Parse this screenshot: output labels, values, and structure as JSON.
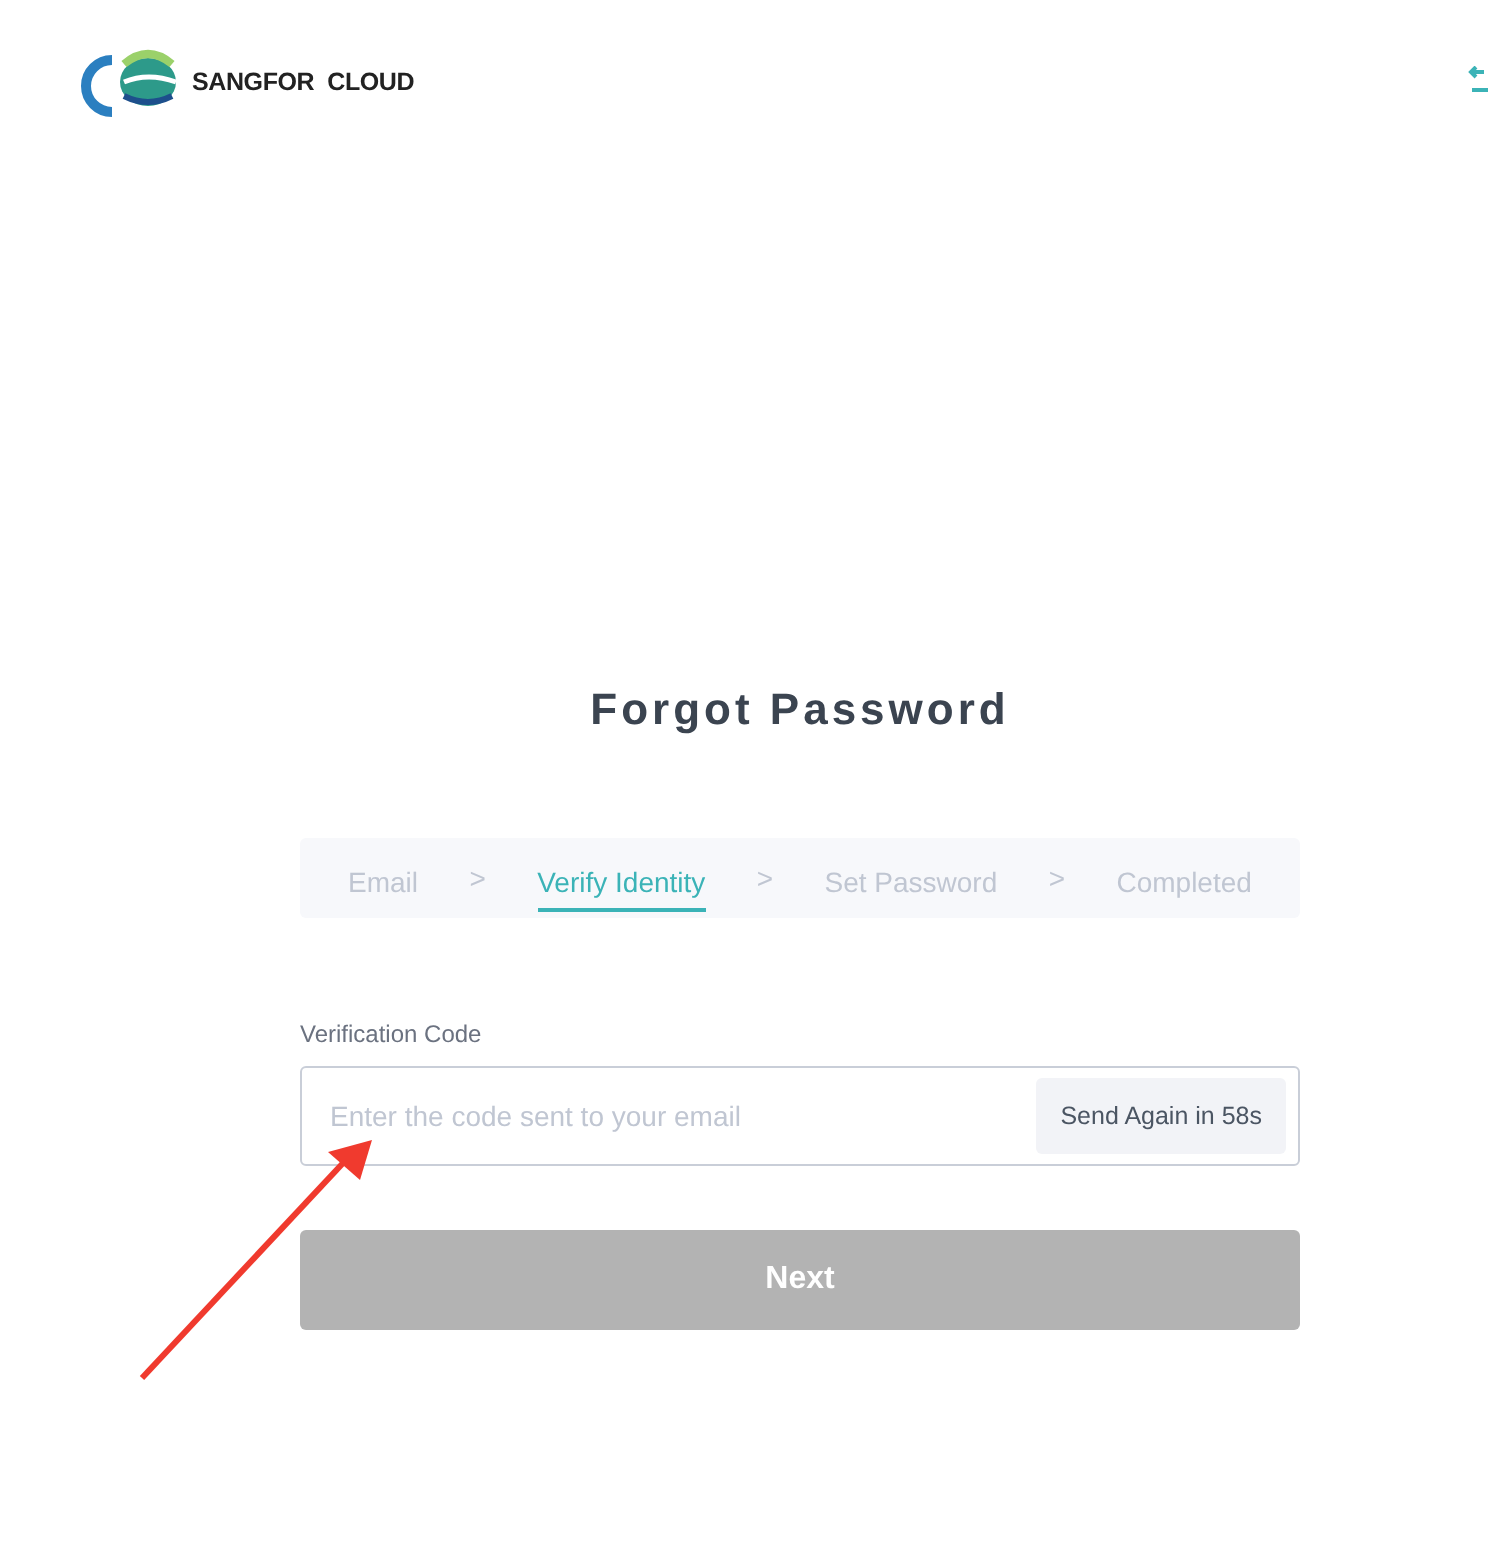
{
  "brand": {
    "name": "SANGFOR  CLOUD"
  },
  "title": "Forgot Password",
  "steps": [
    {
      "label": "Email",
      "selected": false
    },
    {
      "label": "Verify Identity",
      "selected": true
    },
    {
      "label": "Set Password",
      "selected": false
    },
    {
      "label": "Completed",
      "selected": false
    }
  ],
  "step_separator": ">",
  "field": {
    "label": "Verification Code",
    "placeholder": "Enter the code sent to your email",
    "action": "Send Again in 58s"
  },
  "next_button": {
    "label": "Next",
    "disabled": true
  }
}
